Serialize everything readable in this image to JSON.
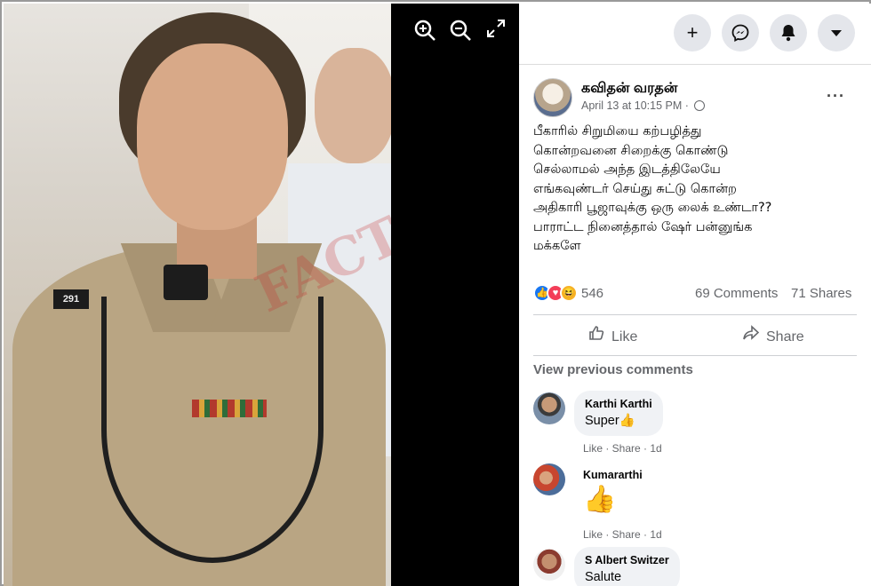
{
  "viewer": {
    "zoom_in_icon": "zoom-in-icon",
    "zoom_out_icon": "zoom-out-icon",
    "fullscreen_icon": "fullscreen-icon"
  },
  "topbar": {
    "create_icon": "+",
    "messenger_icon": "messenger-icon",
    "notifications_icon": "bell-icon",
    "account_icon": "chevron-down-icon"
  },
  "post": {
    "author": "கவிதன் வரதன்",
    "timestamp": "April 13 at 10:15 PM ·",
    "more_label": "···",
    "text": "பீகாரில் சிறுமியை கற்பழித்து\nகொன்றவனை சிறைக்கு கொண்டு\nசெல்லாமல் அந்த இடத்திலேயே\nஎங்கவுண்டர் செய்து சுட்டு கொன்ற\nஅதிகாரி பூஜாவுக்கு ஒரு லைக் உண்டா??\nபாராட்ட நினைத்தால் ஷேர் பன்னுங்க\nமக்களே",
    "reaction_count": "546",
    "comments_count": "69 Comments",
    "shares_count": "71 Shares",
    "like_label": "Like",
    "share_label": "Share"
  },
  "photo": {
    "shoulder_text": "291",
    "watermark_text": "FACT"
  },
  "comments": {
    "view_previous": "View previous comments",
    "items": [
      {
        "name": "Karthi Karthi",
        "text": "Super👍",
        "actions": "Like · Share · 1d"
      },
      {
        "name": "Kumararthi",
        "text": "👍",
        "actions": "Like · Share · 1d"
      },
      {
        "name": "S Albert Switzer",
        "text": "Salute",
        "actions": ""
      }
    ]
  },
  "colors": {
    "accent": "#1877f2",
    "love": "#f33e58",
    "haha": "#f7b125",
    "muted": "#65676b"
  }
}
